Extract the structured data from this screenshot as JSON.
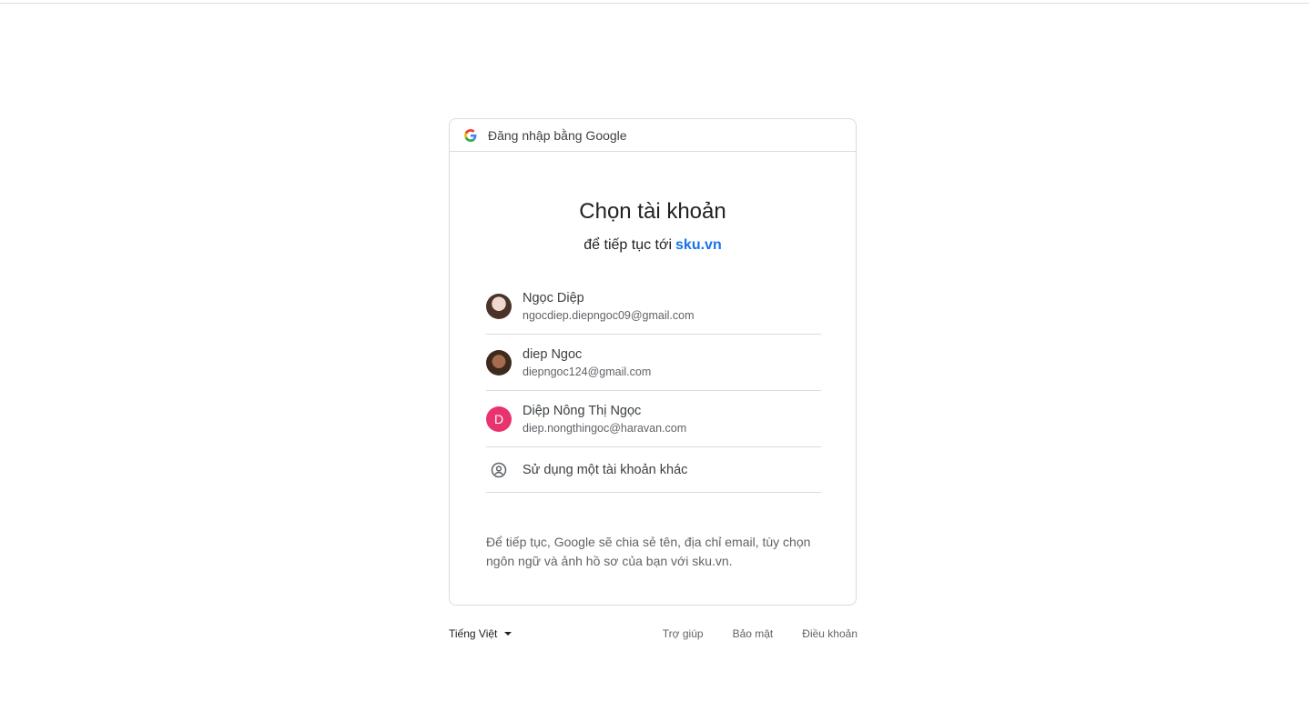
{
  "header": {
    "text": "Đăng nhập bằng Google",
    "logo_icon": "google-g-icon"
  },
  "main": {
    "title": "Chọn tài khoản",
    "subtitle_prefix": "để tiếp tục tới",
    "subtitle_link": "sku.vn",
    "link_color": "#1a73e8"
  },
  "accounts": [
    {
      "name": "Ngọc Diệp",
      "email": "ngocdiep.diepngoc09@gmail.com",
      "avatar": "photo"
    },
    {
      "name": "diep Ngoc",
      "email": "diepngoc124@gmail.com",
      "avatar": "photo"
    },
    {
      "name": "Diệp Nông Thị Ngọc",
      "email": "diep.nongthingoc@haravan.com",
      "avatar_letter": "D",
      "avatar_color": "#e8336f"
    }
  ],
  "other_account": {
    "label": "Sử dụng một tài khoản khác",
    "icon": "account-circle-icon"
  },
  "footnote": "Để tiếp tục, Google sẽ chia sẻ tên, địa chỉ email, tùy chọn ngôn ngữ và ảnh hồ sơ của bạn với sku.vn.",
  "footer": {
    "language": "Tiếng Việt",
    "links": [
      "Trợ giúp",
      "Bảo mật",
      "Điều khoản"
    ]
  }
}
